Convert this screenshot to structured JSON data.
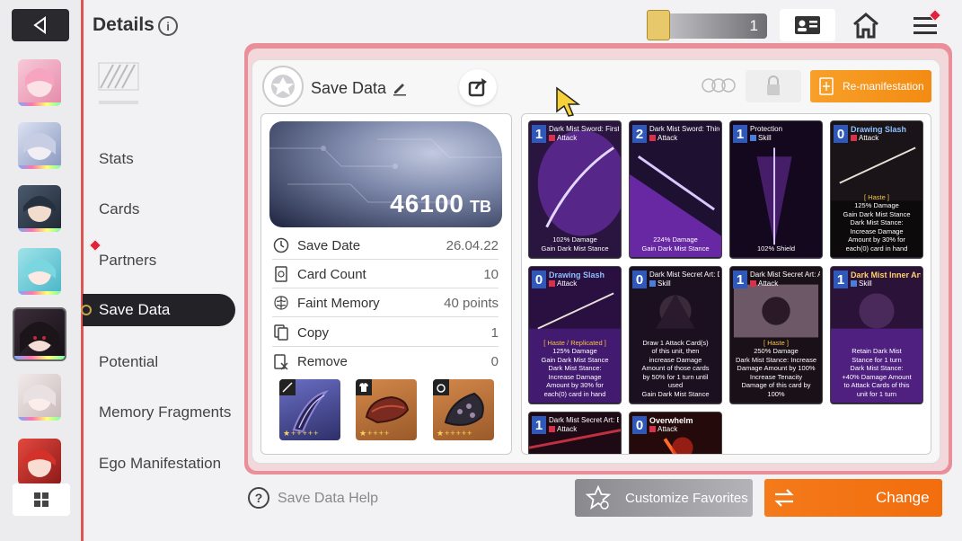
{
  "header": {
    "title": "Details",
    "currency_value": "1"
  },
  "menu": {
    "items": [
      "Stats",
      "Cards",
      "Partners",
      "Save Data",
      "Potential",
      "Memory Fragments",
      "Ego Manifestation"
    ],
    "active": "Save Data"
  },
  "colors": {
    "accent_orange": "#f47a1a",
    "panel_pink": "#e98f9a",
    "badge_red": "#e0233a",
    "dark": "#232327"
  },
  "save_data": {
    "title": "Save Data",
    "remanifest_label": "Re-manifestation",
    "value": "46100",
    "unit": "TB",
    "stats": [
      {
        "label": "Save Date",
        "value": "26.04.22",
        "icon": "clock-icon"
      },
      {
        "label": "Card Count",
        "value": "10",
        "icon": "card-icon"
      },
      {
        "label": "Faint Memory",
        "value": "40 points",
        "icon": "brain-icon"
      },
      {
        "label": "Copy",
        "value": "1",
        "icon": "copy-icon"
      },
      {
        "label": "Remove",
        "value": "0",
        "icon": "remove-icon"
      }
    ],
    "equipment": [
      {
        "slot": "weapon",
        "stars": "★+++++"
      },
      {
        "slot": "armor",
        "stars": "★++++"
      },
      {
        "slot": "accessory",
        "stars": "★+++++"
      }
    ]
  },
  "cards": [
    {
      "cost": "1",
      "name": "Dark Mist Sword: First Form",
      "type": "Attack",
      "desc": "102% Damage\nGain Dark Mist Stance"
    },
    {
      "cost": "2",
      "name": "Dark Mist Sword: Third Form",
      "type": "Attack",
      "desc": "224% Damage\nGain Dark Mist Stance"
    },
    {
      "cost": "1",
      "name": "Protection",
      "type": "Skill",
      "desc": "102% Shield"
    },
    {
      "cost": "0",
      "name": "Drawing Slash",
      "type": "Attack",
      "desc_hl": "[ Haste ]",
      "desc": "125% Damage\nGain Dark Mist Stance\nDark Mist Stance:\nIncrease Damage\nAmount by 30% for\neach(0) card in hand"
    },
    {
      "cost": "0",
      "name": "Drawing Slash",
      "type": "Attack",
      "desc_hl": "[ Haste / Replicated ]",
      "desc": "125% Damage\nGain Dark Mist Stance\nDark Mist Stance:\nIncrease Damage\nAmount by 30% for\neach(0) card in hand"
    },
    {
      "cost": "0",
      "name": "Dark Mist Secret Art: Destruction",
      "type": "Skill",
      "desc": "Draw 1 Attack Card(s)\nof this unit, then\nincrease Damage\nAmount of those cards\nby 50% for 1 turn until\nused\nGain Dark Mist Stance"
    },
    {
      "cost": "1",
      "name": "Dark Mist Secret Art: Annihilation",
      "type": "Attack",
      "desc_hl": "[ Haste ]",
      "desc": "250% Damage\nDark Mist Stance: Increase\nDamage Amount by 100%\nIncrease Tenacity\nDamage of this card by\n100%"
    },
    {
      "cost": "1",
      "name": "Dark Mist Inner Art",
      "type": "Skill",
      "desc": "Retain Dark Mist\nStance for 1 turn\nDark Mist Stance:\n+40% Damage Amount\nto Attack Cards of this\nunit for 1 turn"
    },
    {
      "cost": "1",
      "name": "Dark Mist Secret Art: Black Dance",
      "type": "Attack",
      "desc": ""
    },
    {
      "cost": "0",
      "name": "Overwhelm",
      "type": "Attack",
      "desc": ""
    }
  ],
  "footer": {
    "help_label": "Save Data Help",
    "favorites_label": "Customize Favorites",
    "change_label": "Change"
  }
}
